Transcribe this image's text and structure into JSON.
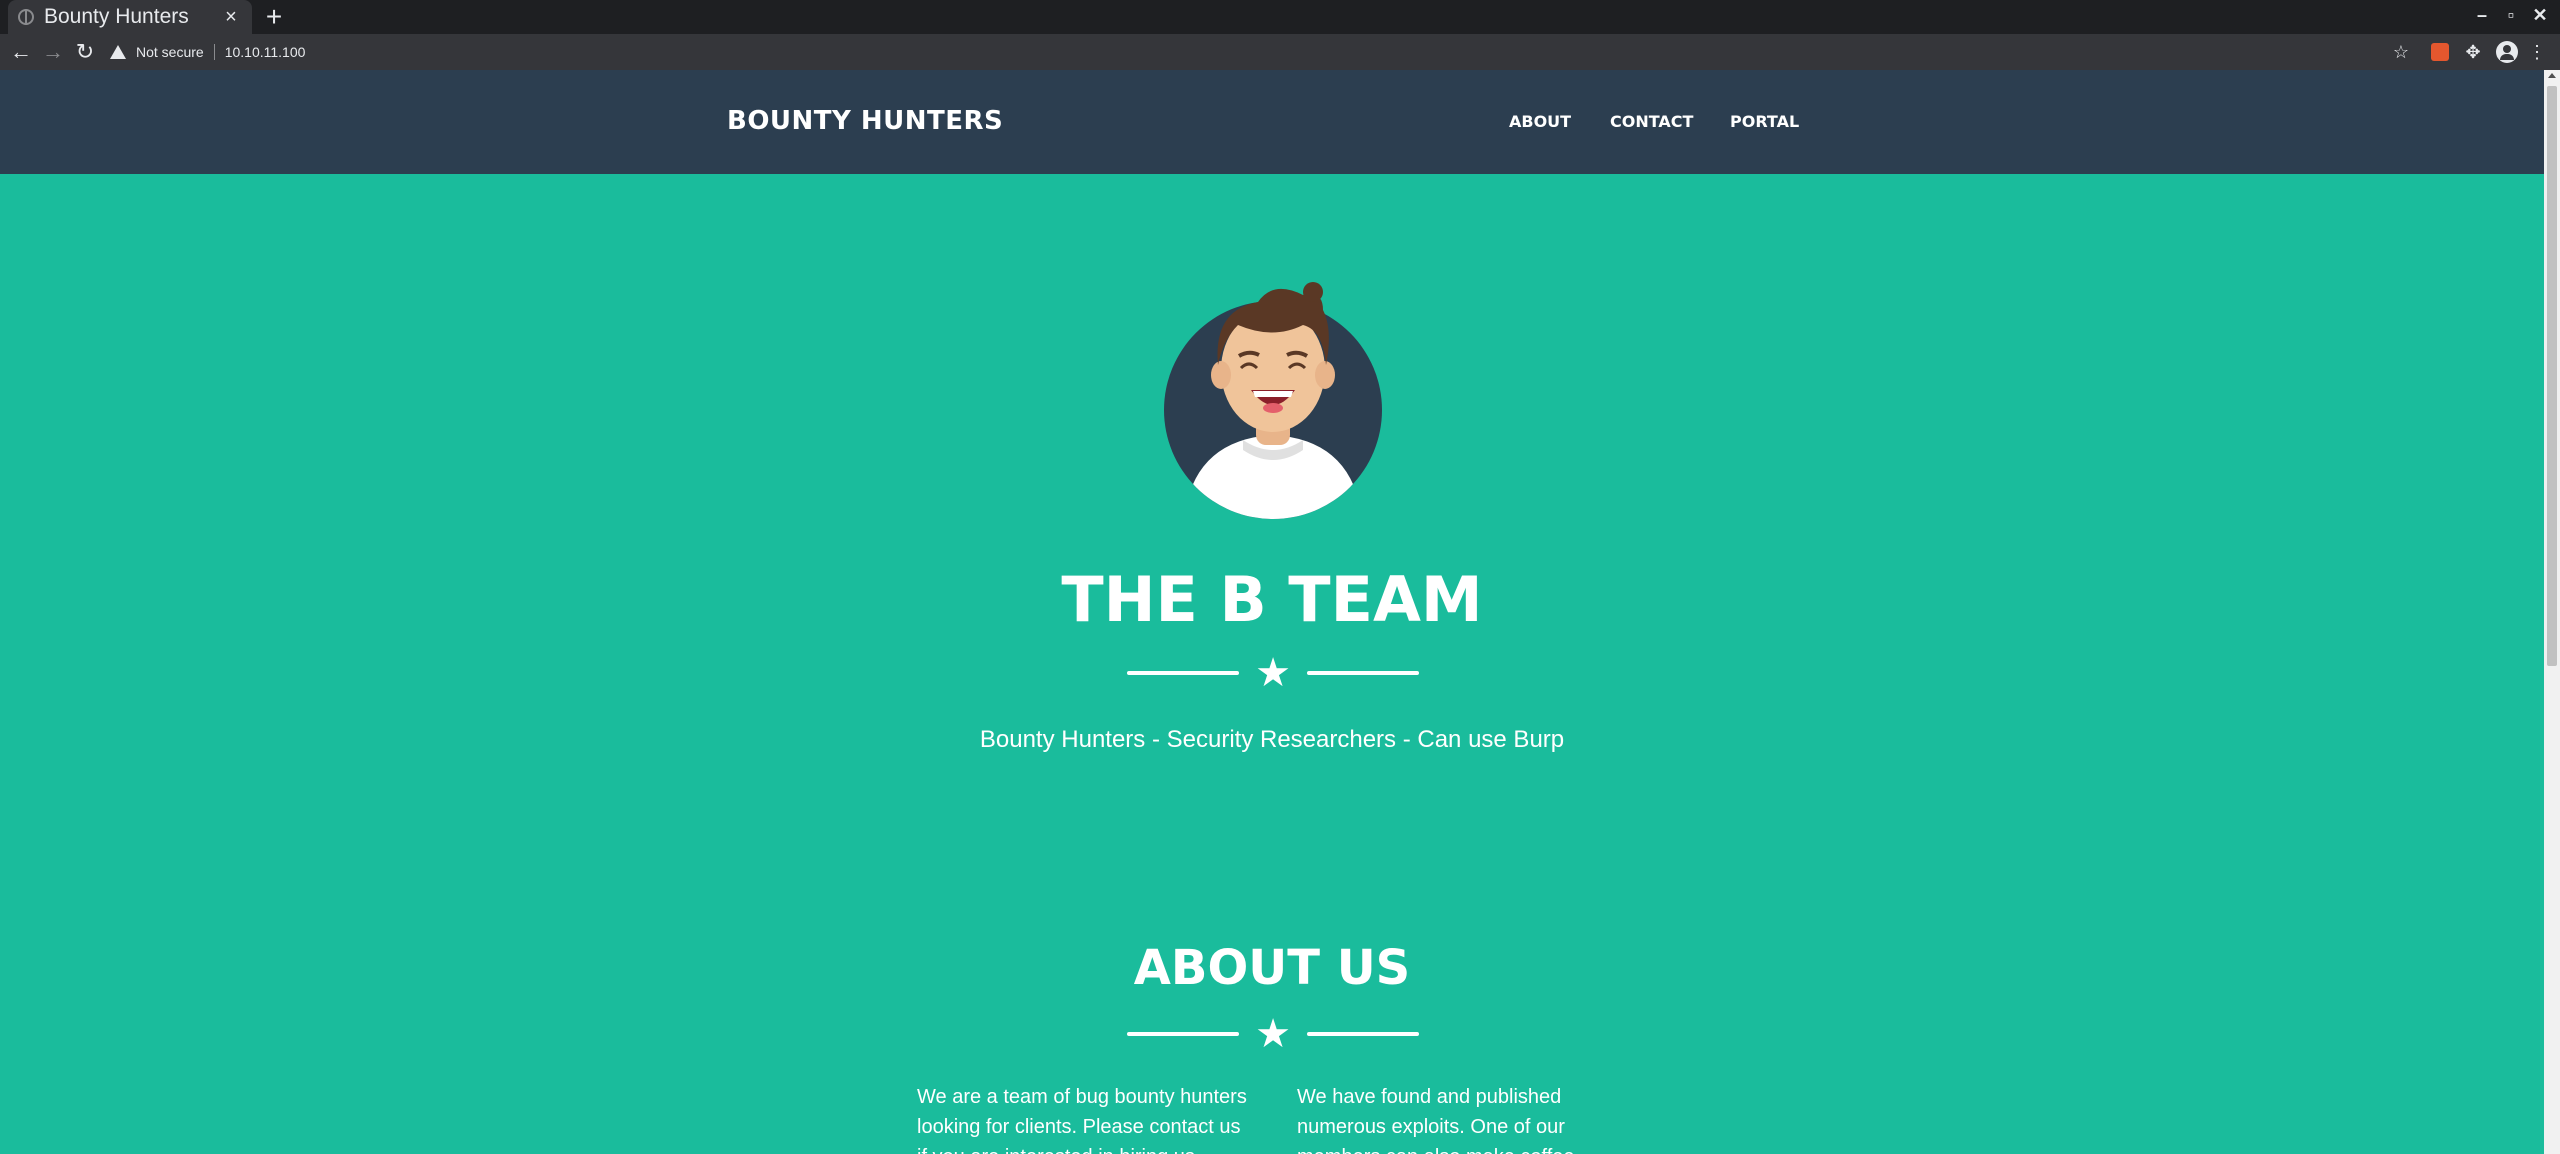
{
  "browser": {
    "tab_title": "Bounty Hunters",
    "close_glyph": "×",
    "new_tab_glyph": "+",
    "security_label": "Not secure",
    "url": "10.10.11.100",
    "window_controls": {
      "minimize": "–",
      "maximize": "▫",
      "close": "✕"
    },
    "icons": {
      "back": "←",
      "forward": "→",
      "reload": "↻",
      "bookmark": "☆",
      "extensions": "✥",
      "menu": "⋮"
    }
  },
  "navbar": {
    "brand": "BOUNTY HUNTERS",
    "links": [
      "ABOUT",
      "CONTACT",
      "PORTAL"
    ],
    "background": "#2c3e50"
  },
  "masthead": {
    "title": "THE B TEAM",
    "subtitle": "Bounty Hunters - Security Researchers - Can use Burp",
    "divider_icon": "★",
    "background": "#1abc9c"
  },
  "about": {
    "title": "ABOUT US",
    "divider_icon": "★",
    "column_left": "We are a team of bug bounty hunters looking for clients. Please contact us if you are interested in hiring us.",
    "column_right": "We have found and published numerous exploits. One of our members can also make coffee."
  }
}
